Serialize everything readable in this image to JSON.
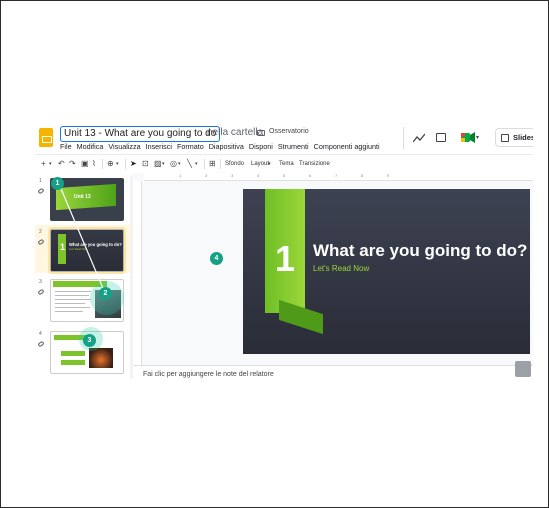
{
  "header": {
    "doc_title": "Unit 13 - What are you going to do",
    "folder_prefix": "nella cartella",
    "folder_name": "Osservatorio",
    "slideshow_label": "Slideshow"
  },
  "menu": [
    "File",
    "Modifica",
    "Visualizza",
    "Inserisci",
    "Formato",
    "Diapositiva",
    "Disponi",
    "Strumenti",
    "Componenti aggiunti"
  ],
  "toolbar": {
    "background": "Sfondo",
    "layout": "Layout",
    "theme": "Tema",
    "transition": "Transizione"
  },
  "filmstrip": {
    "slides": [
      {
        "number": "1",
        "title": "Unit 13"
      },
      {
        "number": "2",
        "title": "What are you going to do?",
        "subtitle": "Let's Read Now"
      },
      {
        "number": "3"
      },
      {
        "number": "4"
      }
    ]
  },
  "rulers": [
    "1",
    "2",
    "3",
    "4",
    "5",
    "6",
    "7",
    "8",
    "9"
  ],
  "slide": {
    "number": "1",
    "title": "What are you going to do?",
    "subtitle": "Let's Read Now"
  },
  "notes_placeholder": "Fai clic per aggiungere le note del relatore",
  "callouts": [
    "1",
    "2",
    "3",
    "4"
  ],
  "colors": {
    "accent_green": "#7cc42a",
    "slide_bg": "#353945",
    "callout": "#16a085",
    "title_focus": "#1a73e8"
  }
}
